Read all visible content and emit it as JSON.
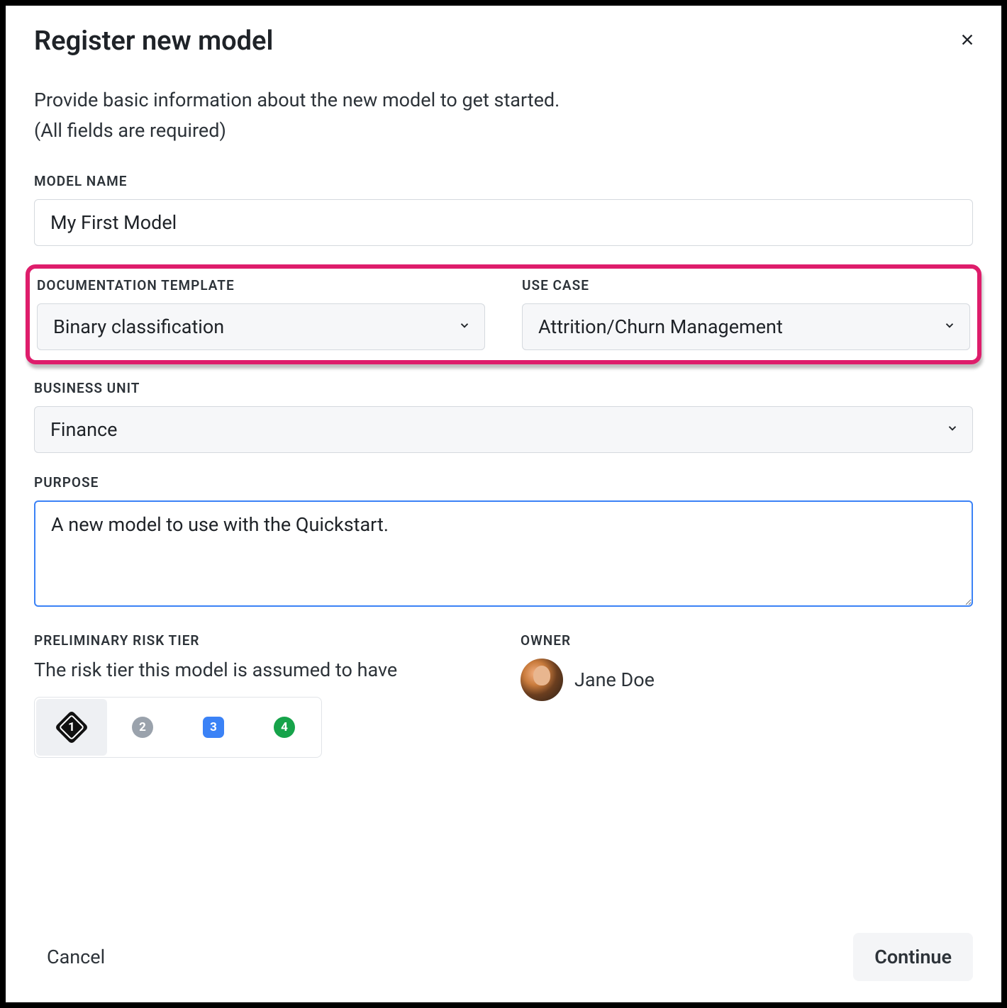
{
  "modal": {
    "title": "Register new model",
    "intro_line1": "Provide basic information about the new model to get started.",
    "intro_line2": "(All fields are required)"
  },
  "fields": {
    "model_name": {
      "label": "MODEL NAME",
      "value": "My First Model"
    },
    "documentation_template": {
      "label": "DOCUMENTATION TEMPLATE",
      "value": "Binary classification"
    },
    "use_case": {
      "label": "USE CASE",
      "value": "Attrition/Churn Management"
    },
    "business_unit": {
      "label": "BUSINESS UNIT",
      "value": "Finance"
    },
    "purpose": {
      "label": "PURPOSE",
      "value": "A new model to use with the Quickstart."
    },
    "risk_tier": {
      "label": "PRELIMINARY RISK TIER",
      "subtitle": "The risk tier this model is assumed to have",
      "tiers": [
        "1",
        "2",
        "3",
        "4"
      ],
      "selected": "1"
    },
    "owner": {
      "label": "OWNER",
      "name": "Jane Doe"
    }
  },
  "footer": {
    "cancel": "Cancel",
    "continue": "Continue"
  }
}
